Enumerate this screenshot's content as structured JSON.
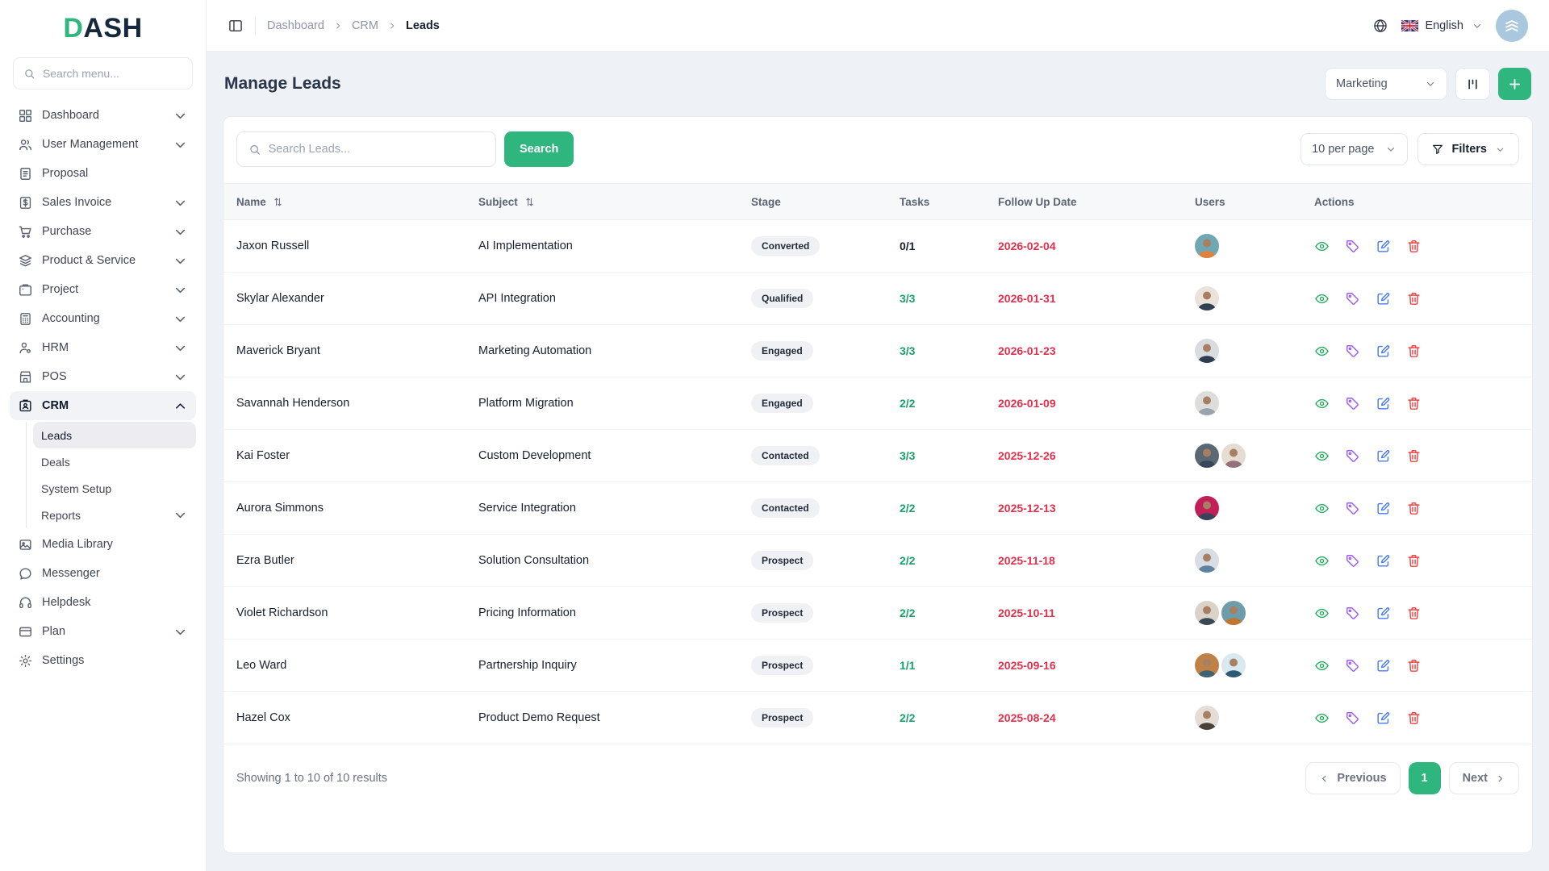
{
  "brand": {
    "logo_accent": "D",
    "logo_rest": "ASH",
    "accent_color": "#2eb67e"
  },
  "sidebar": {
    "search_placeholder": "Search menu...",
    "items": [
      {
        "label": "Dashboard",
        "icon": "grid",
        "chevron": "down"
      },
      {
        "label": "User Management",
        "icon": "users",
        "chevron": "down"
      },
      {
        "label": "Proposal",
        "icon": "proposal",
        "chevron": null
      },
      {
        "label": "Sales Invoice",
        "icon": "invoice",
        "chevron": "down"
      },
      {
        "label": "Purchase",
        "icon": "cart",
        "chevron": "down"
      },
      {
        "label": "Product & Service",
        "icon": "layers",
        "chevron": "down"
      },
      {
        "label": "Project",
        "icon": "project",
        "chevron": "down"
      },
      {
        "label": "Accounting",
        "icon": "calculator",
        "chevron": "down"
      },
      {
        "label": "HRM",
        "icon": "hrm",
        "chevron": "down"
      },
      {
        "label": "POS",
        "icon": "store",
        "chevron": "down"
      },
      {
        "label": "CRM",
        "icon": "idcard",
        "chevron": "up",
        "active": true,
        "children": [
          {
            "label": "Leads",
            "active": true
          },
          {
            "label": "Deals"
          },
          {
            "label": "System Setup"
          },
          {
            "label": "Reports",
            "chevron": "down"
          }
        ]
      },
      {
        "label": "Media Library",
        "icon": "image",
        "chevron": null
      },
      {
        "label": "Messenger",
        "icon": "chat",
        "chevron": null
      },
      {
        "label": "Helpdesk",
        "icon": "headset",
        "chevron": null
      },
      {
        "label": "Plan",
        "icon": "card",
        "chevron": "down"
      },
      {
        "label": "Settings",
        "icon": "gear",
        "chevron": null
      }
    ]
  },
  "topbar": {
    "breadcrumb": {
      "items": [
        "Dashboard",
        "CRM"
      ],
      "current": "Leads"
    },
    "language_label": "English"
  },
  "page": {
    "title": "Manage Leads",
    "team_select_value": "Marketing"
  },
  "toolbar": {
    "search_placeholder": "Search Leads...",
    "search_button_label": "Search",
    "per_page_value": "10 per page",
    "filters_label": "Filters"
  },
  "table": {
    "columns": [
      {
        "label": "Name",
        "sortable": true
      },
      {
        "label": "Subject",
        "sortable": true
      },
      {
        "label": "Stage",
        "sortable": false
      },
      {
        "label": "Tasks",
        "sortable": false
      },
      {
        "label": "Follow Up Date",
        "sortable": false
      },
      {
        "label": "Users",
        "sortable": false
      },
      {
        "label": "Actions",
        "sortable": false
      }
    ],
    "rows": [
      {
        "name": "Jaxon Russell",
        "subject": "AI Implementation",
        "stage": "Converted",
        "tasks": "0/1",
        "tasks_complete": false,
        "follow_up_date": "2026-02-04",
        "avatars": [
          {
            "bg": "#6fa8b4",
            "shirt": "#e0823d"
          }
        ]
      },
      {
        "name": "Skylar Alexander",
        "subject": "API Integration",
        "stage": "Qualified",
        "tasks": "3/3",
        "tasks_complete": true,
        "follow_up_date": "2026-01-31",
        "avatars": [
          {
            "bg": "#e9e3dc",
            "shirt": "#31404f"
          }
        ]
      },
      {
        "name": "Maverick Bryant",
        "subject": "Marketing Automation",
        "stage": "Engaged",
        "tasks": "3/3",
        "tasks_complete": true,
        "follow_up_date": "2026-01-23",
        "avatars": [
          {
            "bg": "#d8dce1",
            "shirt": "#2e3d50"
          }
        ]
      },
      {
        "name": "Savannah Henderson",
        "subject": "Platform Migration",
        "stage": "Engaged",
        "tasks": "2/2",
        "tasks_complete": true,
        "follow_up_date": "2026-01-09",
        "avatars": [
          {
            "bg": "#dddddb",
            "shirt": "#9aa3ab"
          }
        ]
      },
      {
        "name": "Kai Foster",
        "subject": "Custom Development",
        "stage": "Contacted",
        "tasks": "3/3",
        "tasks_complete": true,
        "follow_up_date": "2025-12-26",
        "avatars": [
          {
            "bg": "#5a6874",
            "shirt": "#39485a"
          },
          {
            "bg": "#e5ddd3",
            "shirt": "#93707a"
          }
        ]
      },
      {
        "name": "Aurora Simmons",
        "subject": "Service Integration",
        "stage": "Contacted",
        "tasks": "2/2",
        "tasks_complete": true,
        "follow_up_date": "2025-12-13",
        "avatars": [
          {
            "bg": "#c21e57",
            "shirt": "#33445c"
          }
        ]
      },
      {
        "name": "Ezra Butler",
        "subject": "Solution Consultation",
        "stage": "Prospect",
        "tasks": "2/2",
        "tasks_complete": true,
        "follow_up_date": "2025-11-18",
        "avatars": [
          {
            "bg": "#d7dee3",
            "shirt": "#5d83a0"
          }
        ]
      },
      {
        "name": "Violet Richardson",
        "subject": "Pricing Information",
        "stage": "Prospect",
        "tasks": "2/2",
        "tasks_complete": true,
        "follow_up_date": "2025-10-11",
        "avatars": [
          {
            "bg": "#d9d3c9",
            "shirt": "#3c4854"
          },
          {
            "bg": "#6d9dab",
            "shirt": "#c0762f"
          }
        ]
      },
      {
        "name": "Leo Ward",
        "subject": "Partnership Inquiry",
        "stage": "Prospect",
        "tasks": "1/1",
        "tasks_complete": true,
        "follow_up_date": "2025-09-16",
        "avatars": [
          {
            "bg": "#c08147",
            "shirt": "#3e6471"
          },
          {
            "bg": "#d9e9f0",
            "shirt": "#2e5a73"
          }
        ]
      },
      {
        "name": "Hazel Cox",
        "subject": "Product Demo Request",
        "stage": "Prospect",
        "tasks": "2/2",
        "tasks_complete": true,
        "follow_up_date": "2025-08-24",
        "avatars": [
          {
            "bg": "#e3ddd5",
            "shirt": "#4b4138"
          }
        ]
      }
    ]
  },
  "footer": {
    "summary": "Showing 1 to 10 of 10 results",
    "previous_label": "Previous",
    "page_number": "1",
    "next_label": "Next"
  },
  "colors": {
    "accent": "#2eb67e",
    "date_red": "#e2304c",
    "task_green": "#17a269",
    "badge_bg": "#f0f1f4"
  }
}
